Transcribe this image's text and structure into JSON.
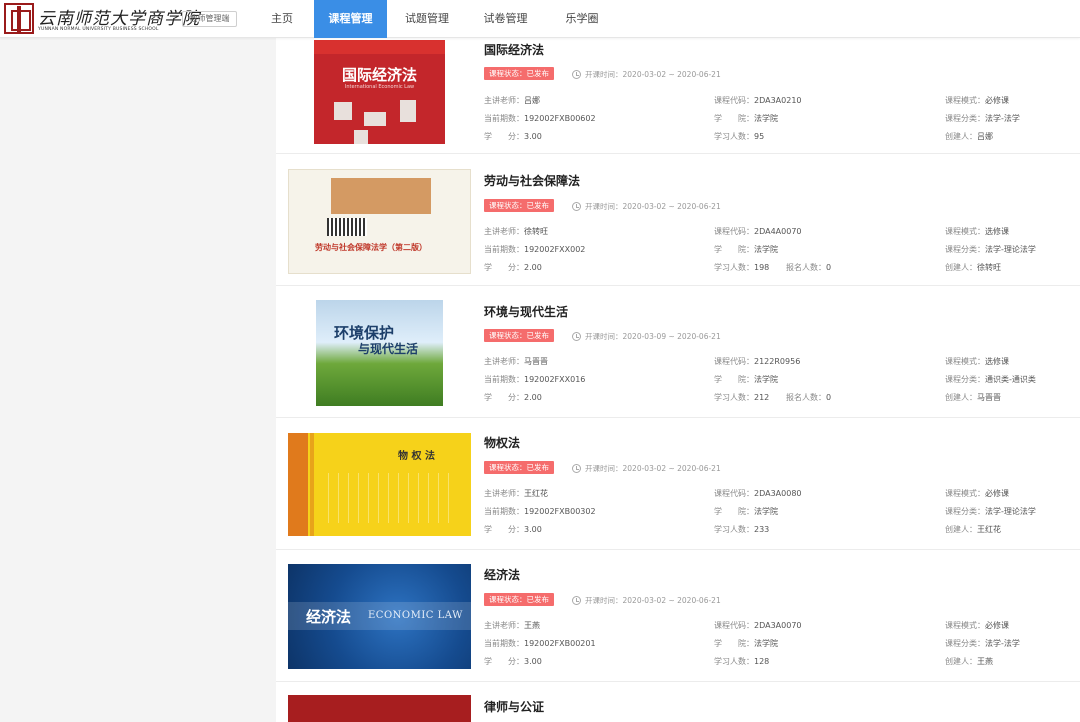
{
  "header": {
    "logo_cn": "云南师范大学商学院",
    "logo_en": "YUNNAN NORMAL UNIVERSITY BUSINESS SCHOOL",
    "portal_button": "教师管理端",
    "nav": [
      "主页",
      "课程管理",
      "试题管理",
      "试卷管理",
      "乐学圈"
    ],
    "active_nav": "课程管理"
  },
  "labels": {
    "teacher": "主讲老师：",
    "code": "课程代码：",
    "mode": "课程模式：",
    "term": "当前期数：",
    "college": "学　　院：",
    "category": "课程分类：",
    "credit": "学　　分：",
    "learners": "学习人数：",
    "enrolled": "报名人数：",
    "creator": "创建人："
  },
  "courses": [
    {
      "title": "国际经济法",
      "status": "课程状态：已发布",
      "date": "开课时间：2020-03-02 ~ 2020-06-21",
      "teacher": "吕娜",
      "code": "2DA3A0210",
      "mode": "必修课",
      "term": "192002FXB00602",
      "college": "法学院",
      "category": "法学-法学",
      "credit": "3.00",
      "learners": "95",
      "enrolled": "",
      "creator": "吕娜",
      "cover_title": "国际经济法",
      "cover_sub": "International Economic Law"
    },
    {
      "title": "劳动与社会保障法",
      "status": "课程状态：已发布",
      "date": "开课时间：2020-03-02 ~ 2020-06-21",
      "teacher": "徐转旺",
      "code": "2DA4A0070",
      "mode": "选修课",
      "term": "192002FXX002",
      "college": "法学院",
      "category": "法学-理论法学",
      "credit": "2.00",
      "learners": "198",
      "enrolled": "0",
      "creator": "徐转旺",
      "cover_title": "劳动与社会保障法学（第二版）"
    },
    {
      "title": "环境与现代生活",
      "status": "课程状态：已发布",
      "date": "开课时间：2020-03-09 ~ 2020-06-21",
      "teacher": "马晋晋",
      "code": "2122R0956",
      "mode": "选修课",
      "term": "192002FXX016",
      "college": "法学院",
      "category": "通识类-通识类",
      "credit": "2.00",
      "learners": "212",
      "enrolled": "0",
      "creator": "马晋晋",
      "cover_title": "环境保护",
      "cover_sub": "与现代生活"
    },
    {
      "title": "物权法",
      "status": "课程状态：已发布",
      "date": "开课时间：2020-03-02 ~ 2020-06-21",
      "teacher": "王红花",
      "code": "2DA3A0080",
      "mode": "必修课",
      "term": "192002FXB00302",
      "college": "法学院",
      "category": "法学-理论法学",
      "credit": "3.00",
      "learners": "233",
      "enrolled": "",
      "creator": "王红花",
      "cover_title": "物 权 法"
    },
    {
      "title": "经济法",
      "status": "课程状态：已发布",
      "date": "开课时间：2020-03-02 ~ 2020-06-21",
      "teacher": "王燕",
      "code": "2DA3A0070",
      "mode": "必修课",
      "term": "192002FXB00201",
      "college": "法学院",
      "category": "法学-法学",
      "credit": "3.00",
      "learners": "128",
      "enrolled": "",
      "creator": "王燕",
      "cover_title": "经济法",
      "cover_sub": "ECONOMIC LAW"
    },
    {
      "title": "律师与公证"
    }
  ]
}
